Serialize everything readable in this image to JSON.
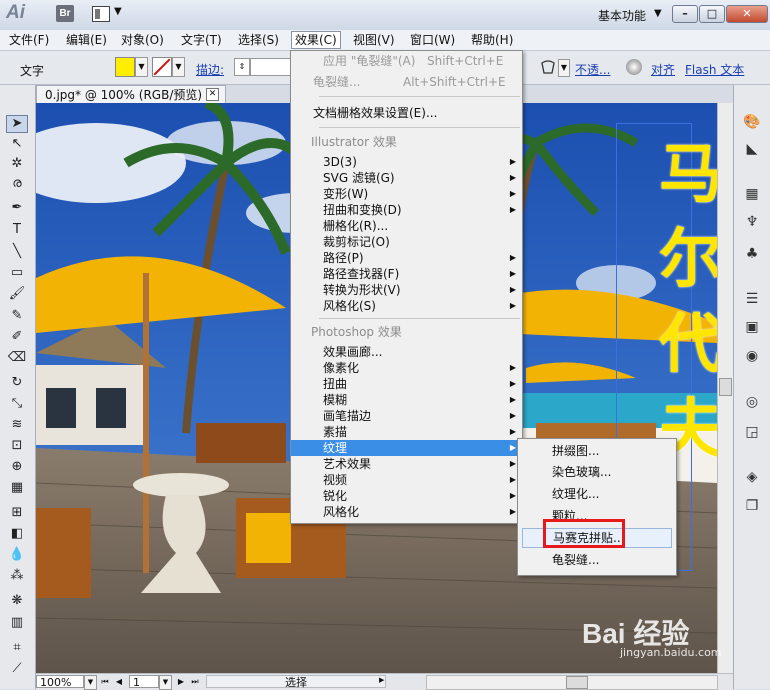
{
  "titlebar": {
    "br_label": "Br",
    "workspace": "基本功能",
    "minimize": "–",
    "maximize": "□",
    "close": "✕"
  },
  "menubar": {
    "items": [
      "文件(F)",
      "编辑(E)",
      "对象(O)",
      "文字(T)",
      "选择(S)",
      "效果(C)",
      "视图(V)",
      "窗口(W)",
      "帮助(H)"
    ]
  },
  "control_bar": {
    "tool_label": "文字",
    "stroke_label": "描边:",
    "opacity_label": "不透...",
    "align_label": "对齐",
    "flash_label": "Flash 文本",
    "fill_color": "#ffee00"
  },
  "document": {
    "tab_title": "0.jpg* @ 100% (RGB/预览)",
    "vertical_text": [
      "马",
      "尔",
      "代",
      "夫"
    ]
  },
  "status_bar": {
    "zoom": "100%",
    "page": "1",
    "status": "选择"
  },
  "effect_menu": {
    "apply_last": {
      "label": "应用 \"龟裂缝\"(A)",
      "shortcut": "Shift+Ctrl+E"
    },
    "last_effect": {
      "label": "龟裂缝...",
      "shortcut": "Alt+Shift+Ctrl+E"
    },
    "raster_settings": "文档栅格效果设置(E)...",
    "illustrator_header": "Illustrator 效果",
    "illustrator_items": [
      "3D(3)",
      "SVG 滤镜(G)",
      "变形(W)",
      "扭曲和变换(D)",
      "栅格化(R)...",
      "裁剪标记(O)",
      "路径(P)",
      "路径查找器(F)",
      "转换为形状(V)",
      "风格化(S)"
    ],
    "photoshop_header": "Photoshop 效果",
    "photoshop_items": [
      "效果画廊...",
      "像素化",
      "扭曲",
      "模糊",
      "画笔描边",
      "素描",
      "纹理",
      "艺术效果",
      "视频",
      "锐化",
      "风格化"
    ]
  },
  "texture_menu": {
    "items": [
      "拼缀图...",
      "染色玻璃...",
      "纹理化...",
      "颗粒...",
      "马赛克拼贴...",
      "龟裂缝..."
    ]
  },
  "watermark": {
    "text": "Bai 经验",
    "sub": "jingyan.baidu.com"
  }
}
